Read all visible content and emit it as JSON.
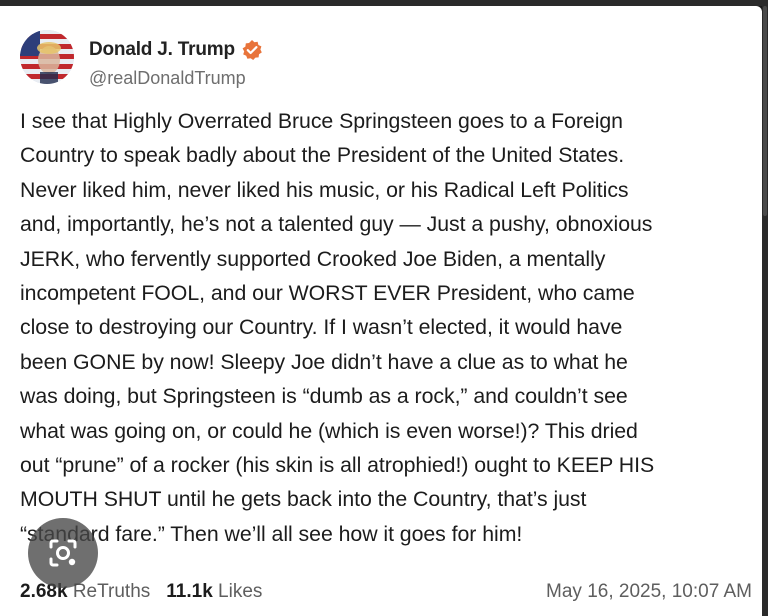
{
  "post": {
    "author": {
      "display_name": "Donald J. Trump",
      "handle": "@realDonaldTrump",
      "avatar_icon": "flag-portrait-avatar",
      "verified_icon": "verified-badge-icon",
      "verified_color": "#e8743b"
    },
    "body_lines": [
      "I see that Highly Overrated Bruce Springsteen goes to a Foreign",
      "Country to speak badly about the President of the United States.",
      "Never liked him, never liked his music, or his Radical Left Politics",
      "and, importantly, he’s not a talented guy — Just a pushy, obnoxious",
      "JERK, who fervently supported Crooked Joe Biden, a mentally",
      "incompetent FOOL, and our WORST EVER President, who came",
      "close to destroying our Country. If I wasn’t elected, it would have",
      "been GONE by now! Sleepy Joe didn’t have a clue as to what he",
      "was doing, but Springsteen is “dumb as a rock,” and couldn’t see",
      "what was going on, or could he (which is even worse!)? This dried",
      "out “prune” of a rocker (his skin is all atrophied!) ought to KEEP HIS",
      "MOUTH SHUT until he gets back into the Country, that’s just",
      "“standard fare.” Then we’ll all see how it goes for him!"
    ],
    "stats": {
      "retruths_count": "2.68k",
      "retruths_label": "ReTruths",
      "likes_count": "11.1k",
      "likes_label": "Likes"
    },
    "timestamp": "May 16, 2025, 10:07 AM"
  },
  "overlay": {
    "lens_icon": "image-search-lens-icon"
  }
}
